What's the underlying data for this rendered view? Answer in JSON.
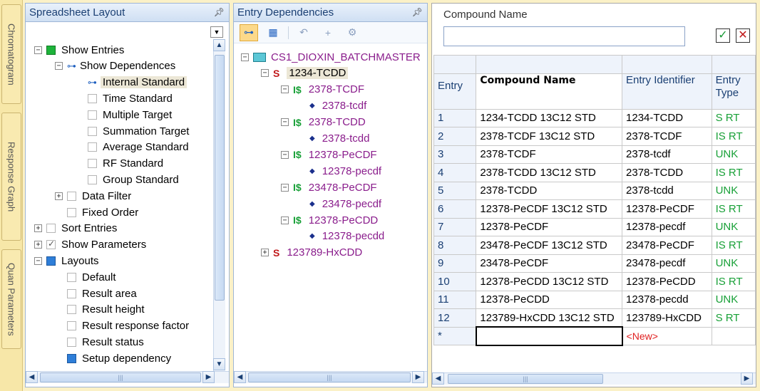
{
  "side_tabs": [
    "Chromatogram",
    "Response Graph",
    "Quan Parameters"
  ],
  "layout_panel": {
    "title": "Spreadsheet Layout",
    "tree": [
      {
        "label": "Show Entries",
        "level": 0,
        "expander": "minus",
        "box": "green"
      },
      {
        "label": "Show Dependences",
        "level": 1,
        "expander": "minus",
        "box": "tree-icon"
      },
      {
        "label": "Internal Standard",
        "level": 2,
        "expander": "",
        "box": "tree-icon",
        "selected": true
      },
      {
        "label": "Time Standard",
        "level": 2,
        "expander": "",
        "box": "empty"
      },
      {
        "label": "Multiple Target",
        "level": 2,
        "expander": "",
        "box": "empty"
      },
      {
        "label": "Summation Target",
        "level": 2,
        "expander": "",
        "box": "empty"
      },
      {
        "label": "Average Standard",
        "level": 2,
        "expander": "",
        "box": "empty"
      },
      {
        "label": "RF Standard",
        "level": 2,
        "expander": "",
        "box": "empty"
      },
      {
        "label": "Group Standard",
        "level": 2,
        "expander": "",
        "box": "empty"
      },
      {
        "label": "Data Filter",
        "level": 1,
        "expander": "plus",
        "box": "empty"
      },
      {
        "label": "Fixed Order",
        "level": 1,
        "expander": "",
        "box": "empty"
      },
      {
        "label": "Sort Entries",
        "level": 0,
        "expander": "plus",
        "box": "empty"
      },
      {
        "label": "Show Parameters",
        "level": 0,
        "expander": "plus",
        "box": "check"
      },
      {
        "label": "Layouts",
        "level": 0,
        "expander": "minus",
        "box": "blue"
      },
      {
        "label": "Default",
        "level": 1,
        "expander": "",
        "box": "empty"
      },
      {
        "label": "Result area",
        "level": 1,
        "expander": "",
        "box": "empty"
      },
      {
        "label": "Result height",
        "level": 1,
        "expander": "",
        "box": "empty"
      },
      {
        "label": "Result response factor",
        "level": 1,
        "expander": "",
        "box": "empty"
      },
      {
        "label": "Result status",
        "level": 1,
        "expander": "",
        "box": "empty"
      },
      {
        "label": "Setup dependency",
        "level": 1,
        "expander": "",
        "box": "blue"
      }
    ]
  },
  "dependencies_panel": {
    "title": "Entry Dependencies",
    "toolbar_icons": [
      "tree-view-icon",
      "grid-view-icon",
      "undo-icon",
      "add-icon",
      "options-icon"
    ],
    "root": "CS1_DIOXIN_BATCHMASTER",
    "tree": [
      {
        "label": "1234-TCDD",
        "level": 1,
        "marker": "S",
        "expander": "minus",
        "color": "#8a1d8c",
        "marker_color": "#c0181a",
        "selected": true
      },
      {
        "label": "2378-TCDF",
        "level": 2,
        "marker": "I$",
        "expander": "minus",
        "color": "#8a1d8c",
        "marker_color": "#18a037"
      },
      {
        "label": "2378-tcdf",
        "level": 3,
        "marker": "◆",
        "expander": "",
        "color": "#8a1d8c",
        "marker_color": "#1a2f8c"
      },
      {
        "label": "2378-TCDD",
        "level": 2,
        "marker": "I$",
        "expander": "minus",
        "color": "#8a1d8c",
        "marker_color": "#18a037"
      },
      {
        "label": "2378-tcdd",
        "level": 3,
        "marker": "◆",
        "expander": "",
        "color": "#8a1d8c",
        "marker_color": "#1a2f8c"
      },
      {
        "label": "12378-PeCDF",
        "level": 2,
        "marker": "I$",
        "expander": "minus",
        "color": "#8a1d8c",
        "marker_color": "#18a037"
      },
      {
        "label": "12378-pecdf",
        "level": 3,
        "marker": "◆",
        "expander": "",
        "color": "#8a1d8c",
        "marker_color": "#1a2f8c"
      },
      {
        "label": "23478-PeCDF",
        "level": 2,
        "marker": "I$",
        "expander": "minus",
        "color": "#8a1d8c",
        "marker_color": "#18a037"
      },
      {
        "label": "23478-pecdf",
        "level": 3,
        "marker": "◆",
        "expander": "",
        "color": "#8a1d8c",
        "marker_color": "#1a2f8c"
      },
      {
        "label": "12378-PeCDD",
        "level": 2,
        "marker": "I$",
        "expander": "minus",
        "color": "#8a1d8c",
        "marker_color": "#18a037"
      },
      {
        "label": "12378-pecdd",
        "level": 3,
        "marker": "◆",
        "expander": "",
        "color": "#8a1d8c",
        "marker_color": "#1a2f8c"
      },
      {
        "label": "123789-HxCDD",
        "level": 1,
        "marker": "S",
        "expander": "plus",
        "color": "#8a1d8c",
        "marker_color": "#c0181a"
      }
    ]
  },
  "grid_panel": {
    "filter_label": "Compound Name",
    "filter_value": "",
    "columns": [
      "Entry",
      "Compound Name",
      "Entry Identifier",
      "Entry Type"
    ],
    "rows": [
      [
        "1",
        "1234-TCDD 13C12 STD",
        "1234-TCDD",
        "S RT"
      ],
      [
        "2",
        "2378-TCDF 13C12 STD",
        "2378-TCDF",
        "IS RT"
      ],
      [
        "3",
        "2378-TCDF",
        "2378-tcdf",
        "UNK"
      ],
      [
        "4",
        "2378-TCDD 13C12 STD",
        "2378-TCDD",
        "IS RT"
      ],
      [
        "5",
        "2378-TCDD",
        "2378-tcdd",
        "UNK"
      ],
      [
        "6",
        "12378-PeCDF 13C12 STD",
        "12378-PeCDF",
        "IS RT"
      ],
      [
        "7",
        "12378-PeCDF",
        "12378-pecdf",
        "UNK"
      ],
      [
        "8",
        "23478-PeCDF 13C12 STD",
        "23478-PeCDF",
        "IS RT"
      ],
      [
        "9",
        "23478-PeCDF",
        "23478-pecdf",
        "UNK"
      ],
      [
        "10",
        "12378-PeCDD 13C12 STD",
        "12378-PeCDD",
        "IS RT"
      ],
      [
        "11",
        "12378-PeCDD",
        "12378-pecdd",
        "UNK"
      ],
      [
        "12",
        "123789-HxCDD 13C12 STD",
        "123789-HxCDD",
        "S RT"
      ]
    ],
    "new_row_marker": "*",
    "new_row_placeholder": "<New>",
    "accent": "#18a037",
    "new_color": "#e02020"
  }
}
